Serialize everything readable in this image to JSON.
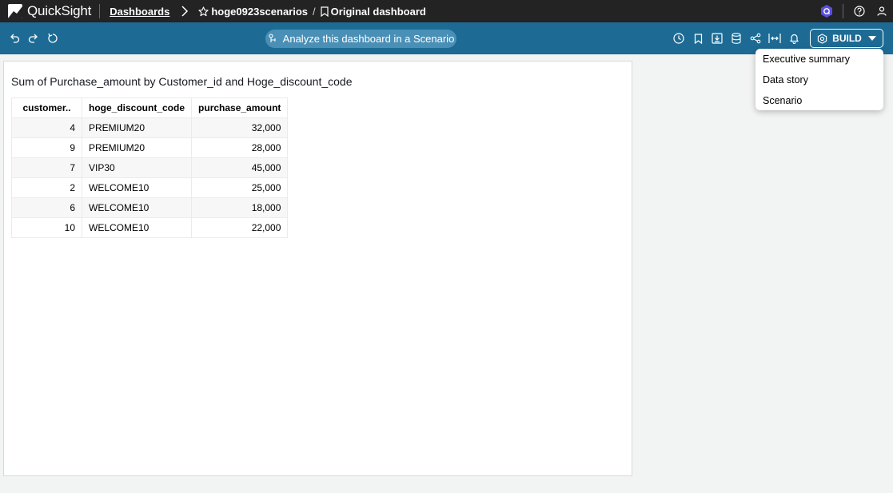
{
  "app": {
    "name": "QuickSight"
  },
  "breadcrumb": {
    "dashboards_label": "Dashboards",
    "analysis_name": "hoge0923scenarios",
    "separator": "/",
    "dashboard_name": "Original dashboard"
  },
  "toolbar": {
    "scenario_button_label": "Analyze this dashboard in a Scenario",
    "build_label": "BUILD",
    "icons": [
      "undo-icon",
      "redo-icon",
      "reset-icon",
      "history-icon",
      "bookmark-icon",
      "export-icon",
      "dataset-icon",
      "share-icon",
      "fit-width-icon",
      "alert-icon"
    ]
  },
  "build_menu": {
    "items": [
      {
        "label": "Executive summary"
      },
      {
        "label": "Data story"
      },
      {
        "label": "Scenario"
      }
    ]
  },
  "visual": {
    "title": "Sum of Purchase_amount by Customer_id and Hoge_discount_code",
    "columns": [
      "customer..",
      "hoge_discount_code",
      "purchase_amount"
    ],
    "rows": [
      {
        "customer_id": "4",
        "code": "PREMIUM20",
        "amount": "32,000"
      },
      {
        "customer_id": "9",
        "code": "PREMIUM20",
        "amount": "28,000"
      },
      {
        "customer_id": "7",
        "code": "VIP30",
        "amount": "45,000"
      },
      {
        "customer_id": "2",
        "code": "WELCOME10",
        "amount": "25,000"
      },
      {
        "customer_id": "6",
        "code": "WELCOME10",
        "amount": "18,000"
      },
      {
        "customer_id": "10",
        "code": "WELCOME10",
        "amount": "22,000"
      }
    ]
  },
  "colors": {
    "topnav_bg": "#232323",
    "toolbar_bg": "#1d6b94",
    "scenario_pill_bg": "#4a8fb6",
    "page_bg": "#f2f3f3"
  }
}
